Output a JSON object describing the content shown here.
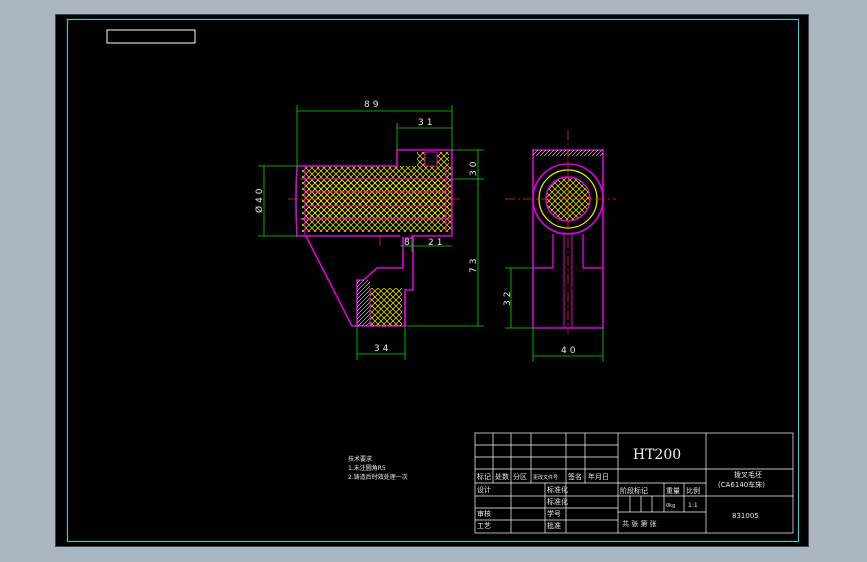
{
  "drawing": {
    "dimensions": {
      "overall_width": "89",
      "right_width": "31",
      "diameter": "Ø40",
      "height_top": "30",
      "overall_height": "73",
      "small_8": "8",
      "small_21": "21",
      "bottom_width": "34",
      "right_view_height": "32",
      "right_view_width": "40"
    },
    "notes": {
      "heading": "技术要求",
      "line1": "1.未注圆角R5",
      "line2": "2.铸造后时效处理一次"
    },
    "title_block": {
      "material": "HT200",
      "part_name_line1": "拨叉毛坯",
      "part_name_line2": "(CA6140车床)",
      "drawing_number": "831005",
      "labels": {
        "biaoji": "标记",
        "chushu": "处数",
        "fenqu": "分区",
        "gengwen": "更改文件号",
        "qianming": "签名",
        "nianyueri": "年月日",
        "sheji": "设计",
        "biaozhunhua": "标准化",
        "shenhe": "审核",
        "gongyi": "工艺",
        "pizhun": "批准",
        "xuehao": "学号",
        "jieduan": "阶段标记",
        "zhongliang": "重量",
        "bili": "比例",
        "zhang": "共  张  第  张",
        "weight_val": "0kg",
        "scale_val": "1:1"
      }
    },
    "colors": {
      "outline": "#e000e0",
      "dimension": "#00e000",
      "hatch": "#f2f200",
      "center": "#ff2020",
      "border": "#00e5e5"
    }
  }
}
